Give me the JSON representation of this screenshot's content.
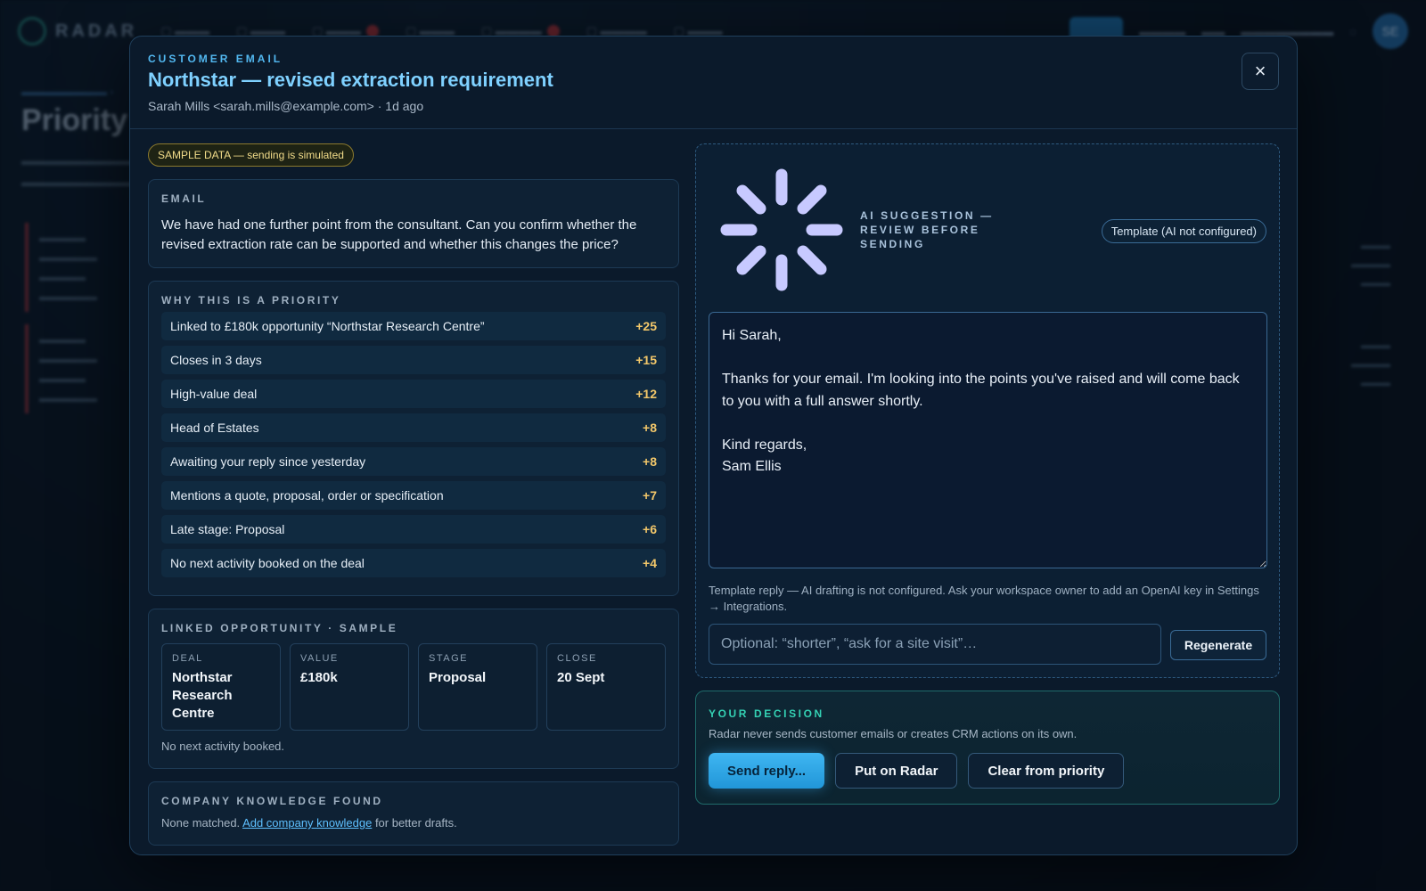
{
  "background": {
    "app_name": "RADAR",
    "avatar_initials": "SE",
    "page_title": "Priority"
  },
  "modal": {
    "eyebrow": "CUSTOMER EMAIL",
    "title": "Northstar — revised extraction requirement",
    "from": "Sarah Mills <sarah.mills@example.com> · 1d ago",
    "close_icon": "×",
    "sample_badge": "SAMPLE DATA — sending is simulated",
    "email": {
      "label": "EMAIL",
      "body": "We have had one further point from the consultant. Can you confirm whether the revised extraction rate can be supported and whether this changes the price?"
    },
    "priority": {
      "label": "WHY THIS IS A PRIORITY",
      "reasons": [
        {
          "text": "Linked to £180k opportunity “Northstar Research Centre”",
          "points": "+25"
        },
        {
          "text": "Closes in 3 days",
          "points": "+15"
        },
        {
          "text": "High-value deal",
          "points": "+12"
        },
        {
          "text": "Head of Estates",
          "points": "+8"
        },
        {
          "text": "Awaiting your reply since yesterday",
          "points": "+8"
        },
        {
          "text": "Mentions a quote, proposal, order or specification",
          "points": "+7"
        },
        {
          "text": "Late stage: Proposal",
          "points": "+6"
        },
        {
          "text": "No next activity booked on the deal",
          "points": "+4"
        }
      ]
    },
    "opportunity": {
      "label": "LINKED OPPORTUNITY · SAMPLE",
      "cells": [
        {
          "key": "DEAL",
          "value": "Northstar Research Centre"
        },
        {
          "key": "VALUE",
          "value": "£180k"
        },
        {
          "key": "STAGE",
          "value": "Proposal"
        },
        {
          "key": "CLOSE",
          "value": "20 Sept"
        }
      ],
      "note": "No next activity booked."
    },
    "knowledge": {
      "label": "COMPANY KNOWLEDGE FOUND",
      "prefix": "None matched. ",
      "link": "Add company knowledge",
      "suffix": " for better drafts."
    },
    "ai": {
      "label": "AI SUGGESTION — REVIEW BEFORE SENDING",
      "template_badge": "Template (AI not configured)",
      "draft": "Hi Sarah,\n\nThanks for your email. I'm looking into the points you've raised and will come back to you with a full answer shortly.\n\nKind regards,\nSam Ellis",
      "help": "Template reply — AI drafting is not configured. Ask your workspace owner to add an OpenAI key in Settings → Integrations.",
      "instruction_placeholder": "Optional: “shorter”, “ask for a site visit”…",
      "regenerate_label": "Regenerate",
      "spinner_icon": "loading-spinner-icon"
    },
    "decision": {
      "label": "YOUR DECISION",
      "sub": "Radar never sends customer emails or creates CRM actions on its own.",
      "send_label": "Send reply...",
      "radar_label": "Put on Radar",
      "clear_label": "Clear from priority"
    }
  },
  "colors": {
    "accent": "#52b8f0",
    "title": "#7fd1ff",
    "points": "#f2c76a",
    "decision_accent": "#34d2b4",
    "badge": "#f2dc8a"
  }
}
